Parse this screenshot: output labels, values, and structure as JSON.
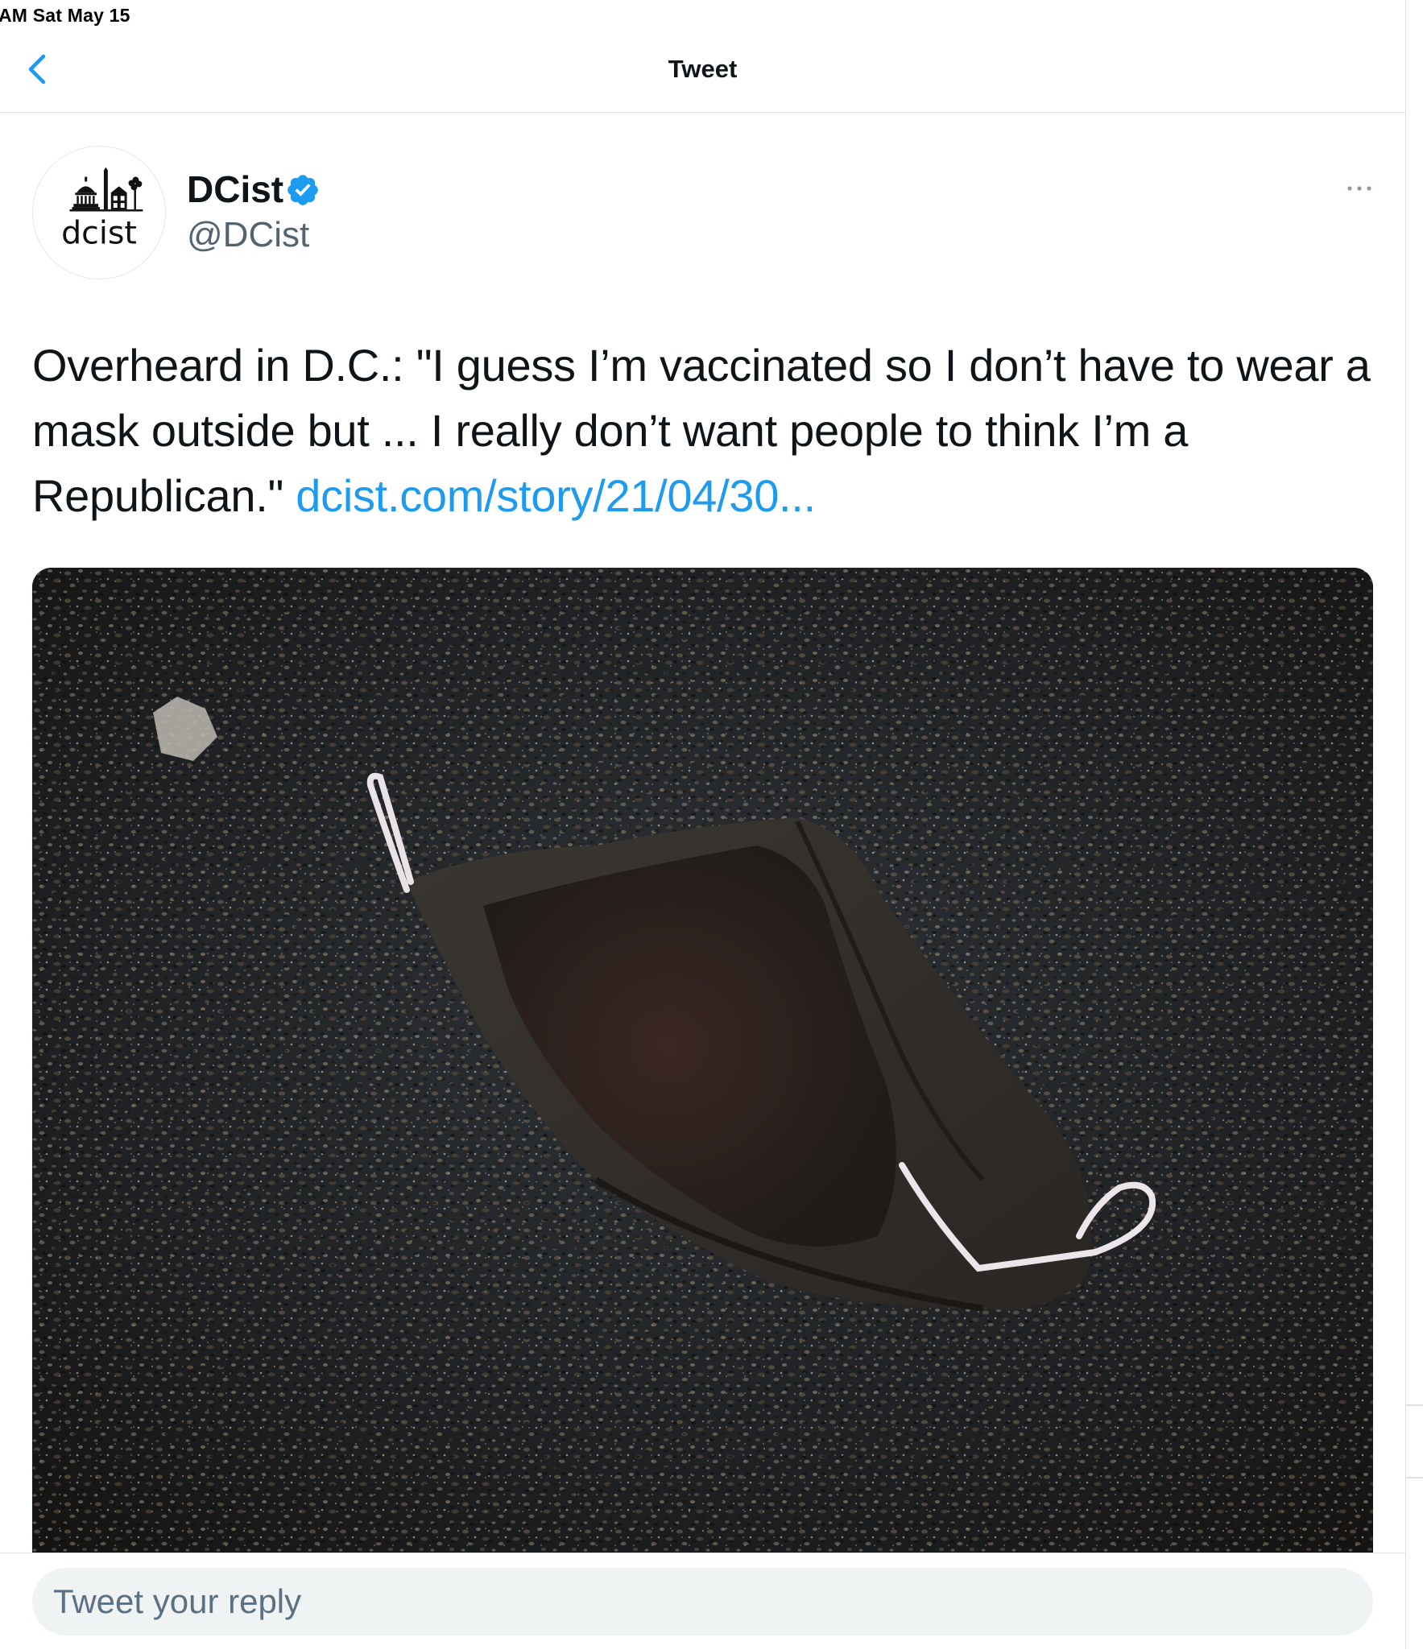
{
  "status_bar": {
    "time": "AM   Sat May 15"
  },
  "header": {
    "back_icon": "chevron-left-icon",
    "title": "Tweet"
  },
  "tweet": {
    "author": {
      "avatar_logo_text": "dcist",
      "name": "DCist",
      "verified": true,
      "handle": "@DCist"
    },
    "more_icon": "ellipsis-icon",
    "text_lines": [
      "Overheard in D.C.: \"I guess I’m vaccinated so I don’t have to wear a",
      "mask outside but ... I really don’t want people to think I’m a",
      "Republican.\""
    ],
    "link_text": "dcist.com/story/21/04/30...",
    "media": {
      "description_icon": "photo-discarded-face-mask"
    }
  },
  "reply": {
    "placeholder": "Tweet your reply"
  },
  "colors": {
    "link": "#1d9bf0",
    "verified": "#1d9bf0",
    "text": "#0f1419",
    "secondary_text": "#536471",
    "divider": "#dbe1e5",
    "reply_background": "#eff3f4"
  }
}
